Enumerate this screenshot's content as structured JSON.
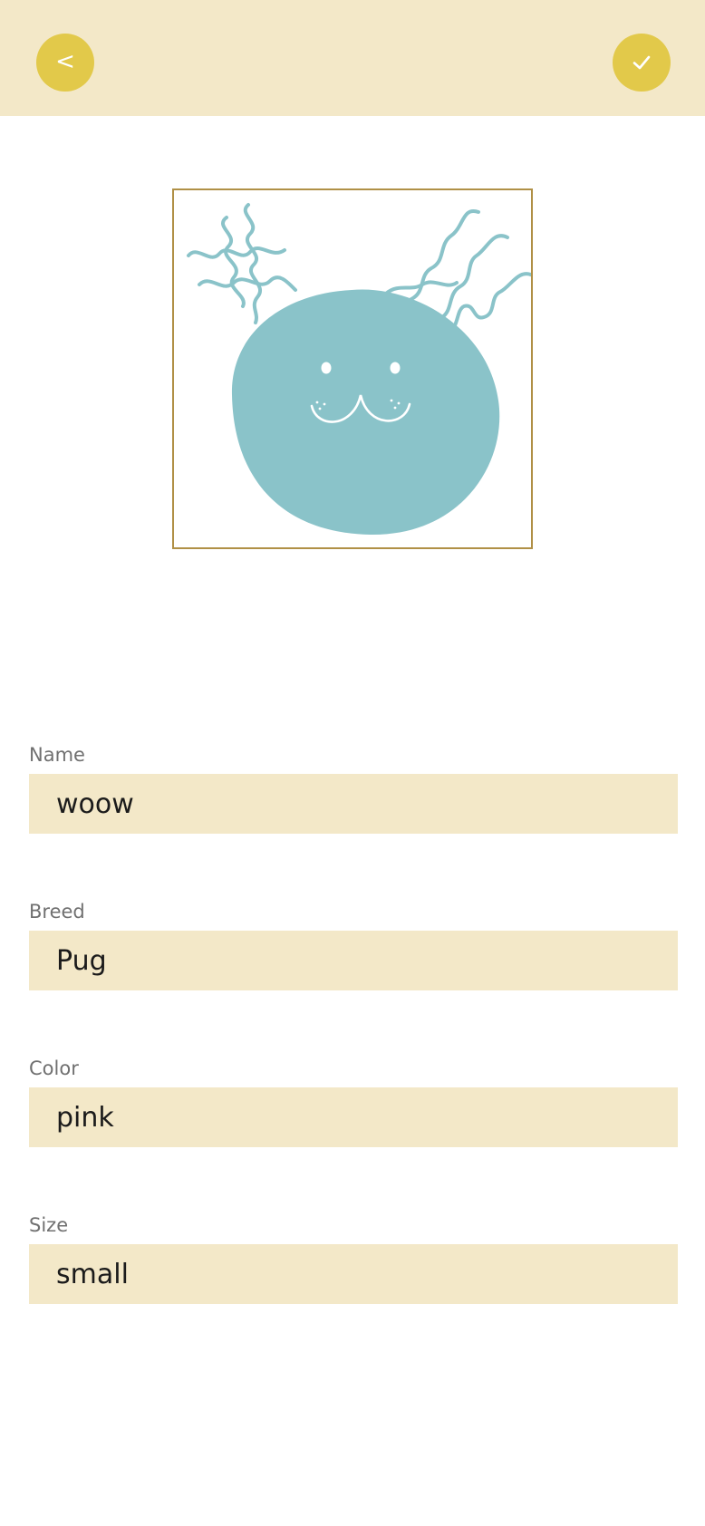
{
  "header": {
    "back_label": "<",
    "background": "#f3e8c8",
    "button_color": "#e2c94a",
    "back_icon": "chevron-left-icon",
    "confirm_icon": "checkmark-icon"
  },
  "avatar": {
    "illustration": "blue-creature-with-curly-antennae",
    "body_color": "#8ac3c9",
    "frame_color": "#b09046"
  },
  "form": {
    "fields": [
      {
        "label": "Name",
        "value": "woow"
      },
      {
        "label": "Breed",
        "value": "Pug"
      },
      {
        "label": "Color",
        "value": "pink"
      },
      {
        "label": "Size",
        "value": "small"
      }
    ]
  }
}
